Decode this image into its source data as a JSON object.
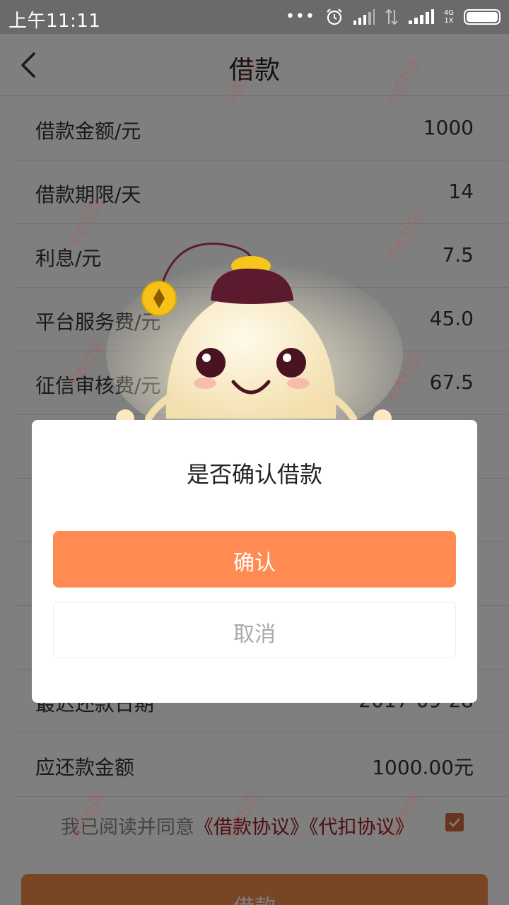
{
  "status_bar": {
    "time": "上午11:11",
    "dots": "•••",
    "network_label_top": "4G",
    "network_label_bottom": "1X"
  },
  "nav": {
    "title": "借款",
    "back_icon": "chevron-left-icon"
  },
  "rows": [
    {
      "label": "借款金额/元",
      "value": "1000"
    },
    {
      "label": "借款期限/天",
      "value": "14"
    },
    {
      "label": "利息/元",
      "value": "7.5"
    },
    {
      "label": "平台服务费/元",
      "value": "45.0"
    },
    {
      "label": "征信审核费/元",
      "value": "67.5"
    },
    {
      "label": "",
      "value": ""
    },
    {
      "label": "",
      "value": ""
    },
    {
      "label": "",
      "value": ""
    },
    {
      "label": "",
      "value": ""
    },
    {
      "label": "最迟还款日期",
      "value": "2017-09-28"
    },
    {
      "label": "应还款金额",
      "value": "1000.00元"
    }
  ],
  "agreement": {
    "prefix": "我已阅读并同意",
    "link1": "《借款协议》",
    "link2": "《代扣协议》",
    "checked": true
  },
  "bottom_button": {
    "label": "借款"
  },
  "dialog": {
    "title": "是否确认借款",
    "confirm_label": "确认",
    "cancel_label": "取消"
  },
  "watermark": {
    "text": "卡农社区"
  },
  "colors": {
    "confirm": "#ff8a52",
    "link": "#a01818",
    "checkbox": "#d2693a",
    "bottom_button": "#f08a4b"
  }
}
